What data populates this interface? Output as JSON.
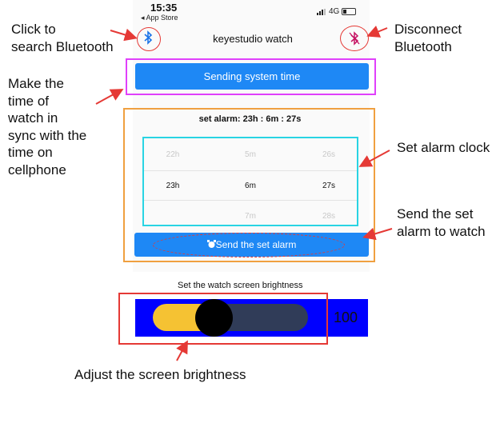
{
  "status_bar": {
    "time": "15:35",
    "back_app": "App Store",
    "network": "4G"
  },
  "app": {
    "title": "keyestudio watch"
  },
  "buttons": {
    "bluetooth_search_icon": "bluetooth-icon",
    "bluetooth_disconnect_icon": "bluetooth-disabled-icon",
    "sync_time": "Sending system time",
    "send_alarm": "Send the set alarm"
  },
  "alarm": {
    "label": "set alarm:  23h : 6m : 27s",
    "picker": {
      "hours": {
        "above": "22h",
        "selected": "23h"
      },
      "minutes": {
        "above": "5m",
        "selected": "6m",
        "below": "7m"
      },
      "seconds": {
        "above": "26s",
        "selected": "27s",
        "below": "28s"
      }
    }
  },
  "brightness": {
    "label": "Set the watch screen brightness",
    "value": "100",
    "level_fraction": 0.3
  },
  "colors": {
    "accent": "#1e88f5",
    "slider_on": "#f5c233",
    "slider_off": "#303c58",
    "panel": "#0000ff",
    "annotation_red": "#e53935"
  },
  "annotations": {
    "search_bluetooth": [
      "Click to",
      "search Bluetooth"
    ],
    "disconnect_bluetooth": [
      "Disconnect",
      "Bluetooth"
    ],
    "sync_time": [
      "Make the",
      "time of",
      "watch in",
      "sync with the",
      "time on",
      "cellphone"
    ],
    "set_alarm_clock": "Set alarm clock",
    "send_alarm": [
      "Send the set",
      "alarm to watch"
    ],
    "adjust_brightness": "Adjust the screen brightness"
  }
}
